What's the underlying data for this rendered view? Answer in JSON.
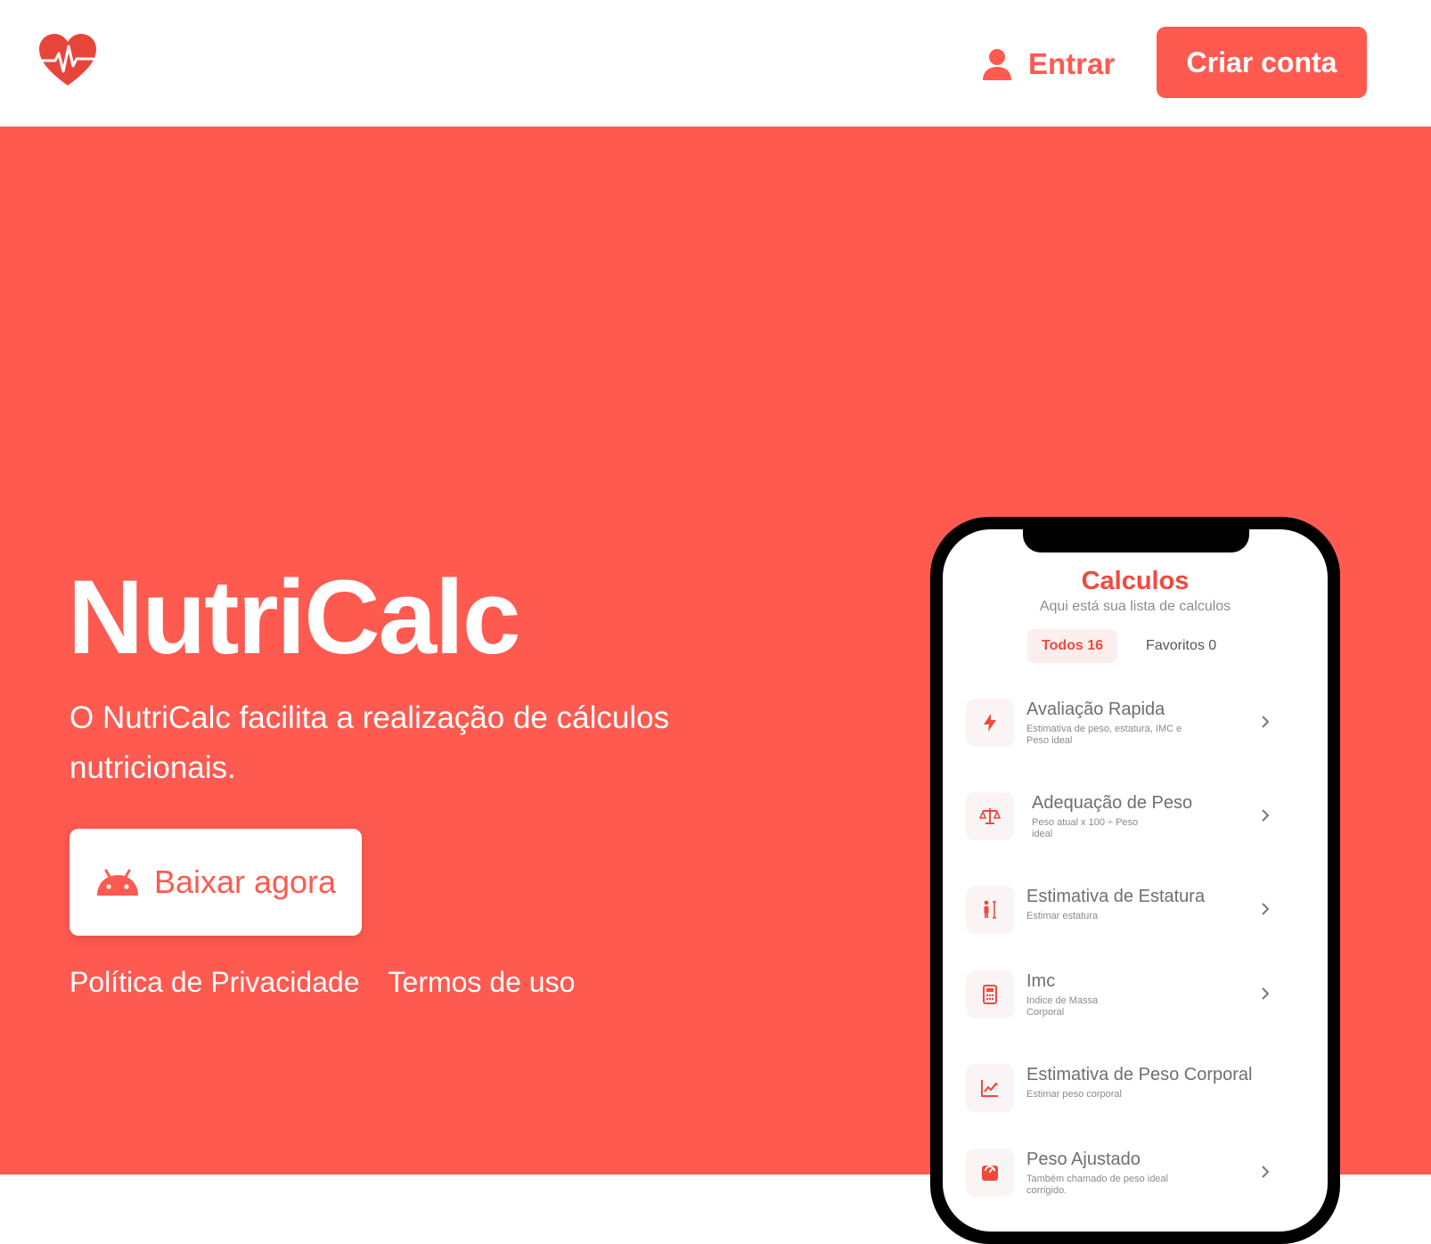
{
  "header": {
    "logo_icon": "heart-pulse-icon",
    "login_label": "Entrar",
    "login_icon": "user-icon",
    "signup_label": "Criar conta"
  },
  "hero": {
    "title": "NutriCalc",
    "description": "O NutriCalc facilita a realização de cálculos nutricionais.",
    "download_label": "Baixar agora",
    "download_icon": "android-icon",
    "links": [
      "Política de Privacidade",
      "Termos de uso"
    ]
  },
  "phone": {
    "title": "Calculos",
    "subtitle": "Aqui está sua lista de calculos",
    "tabs": [
      {
        "label": "Todos 16",
        "active": true
      },
      {
        "label": "Favoritos 0",
        "active": false
      }
    ],
    "items": [
      {
        "title": "Avaliação Rapida",
        "desc": "Estimativa de peso, estatura, IMC e Peso ideal",
        "icon": "lightning-icon"
      },
      {
        "title": "Adequação de Peso",
        "desc": "Peso atual x 100 ÷ Peso ideal",
        "icon": "scale-balance-icon"
      },
      {
        "title": "Estimativa de Estatura",
        "desc": "Estimar estatura",
        "icon": "human-height-icon"
      },
      {
        "title": "Imc",
        "desc": "Indice de Massa Corporal",
        "icon": "calculator-icon"
      },
      {
        "title": "Estimativa de Peso Corporal",
        "desc": "Estimar peso corporal",
        "icon": "chart-line-icon"
      },
      {
        "title": "Peso Ajustado",
        "desc": "Também chamado de peso ideal corrigido.",
        "icon": "weight-scale-icon"
      }
    ]
  },
  "colors": {
    "brand": "#ff5a50",
    "brand_dark": "#f04a3e",
    "white": "#ffffff"
  }
}
